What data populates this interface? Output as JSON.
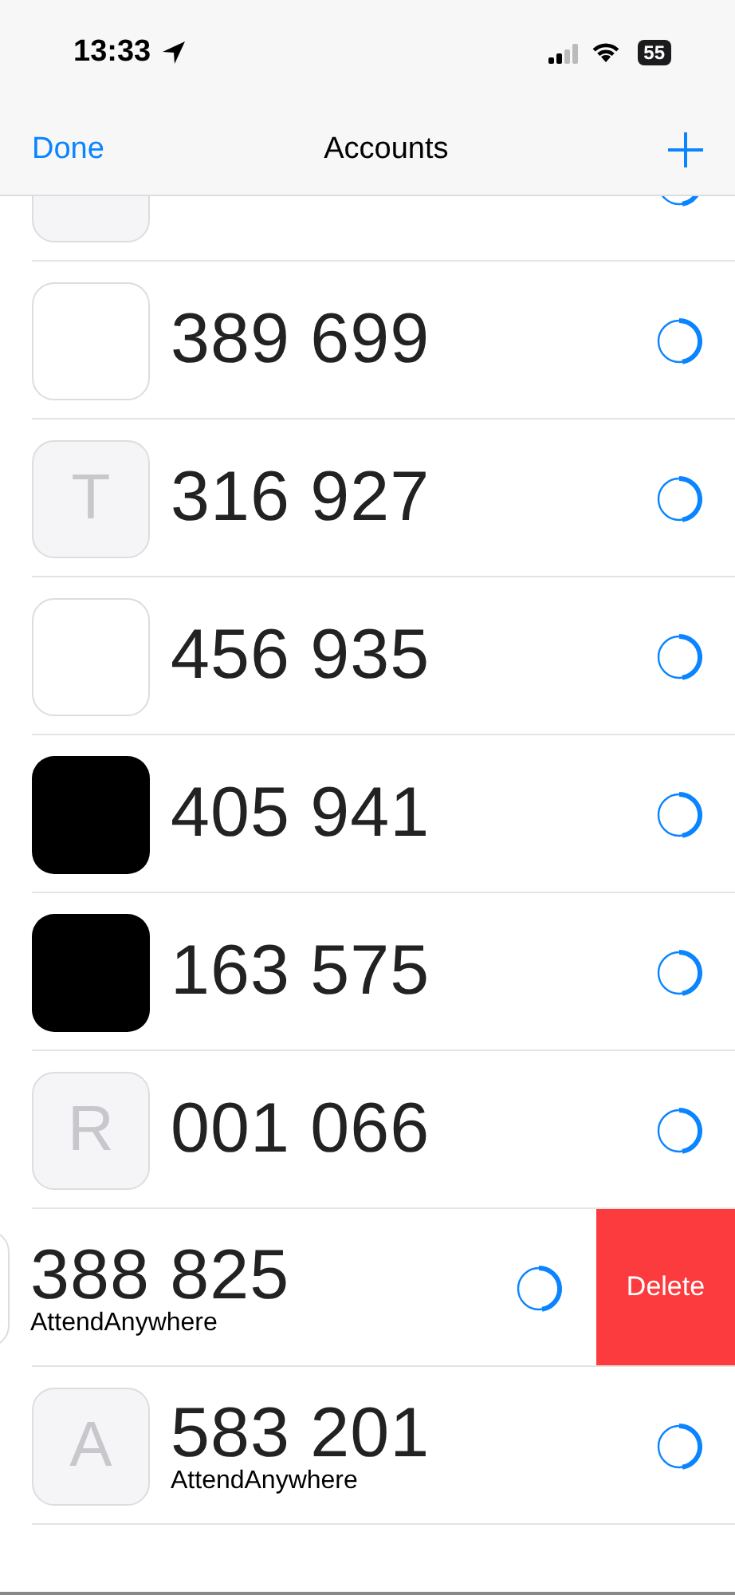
{
  "status_bar": {
    "time": "13:33",
    "battery": "55"
  },
  "nav": {
    "left": "Done",
    "title": "Accounts"
  },
  "accounts": [
    {
      "kind": "letter",
      "swiped": false,
      "partial": true
    },
    {
      "kind": "blank",
      "code": "389 699",
      "swiped": false,
      "partial": false
    },
    {
      "kind": "letter",
      "letter": "T",
      "code": "316 927",
      "swiped": false,
      "partial": false
    },
    {
      "kind": "blank",
      "code": "456 935",
      "swiped": false,
      "partial": false
    },
    {
      "kind": "black",
      "code": "405 941",
      "swiped": false,
      "partial": false
    },
    {
      "kind": "black",
      "code": "163 575",
      "swiped": false,
      "partial": false
    },
    {
      "kind": "letter",
      "letter": "R",
      "code": "001 066",
      "swiped": false,
      "partial": false
    },
    {
      "kind": "blank",
      "code": "388 825",
      "issuer": "AttendAnywhere",
      "swiped": true,
      "partial": false,
      "action": "Delete"
    },
    {
      "kind": "letter",
      "letter": "A",
      "code": "583 201",
      "issuer": "AttendAnywhere",
      "swiped": false,
      "partial": false
    }
  ]
}
